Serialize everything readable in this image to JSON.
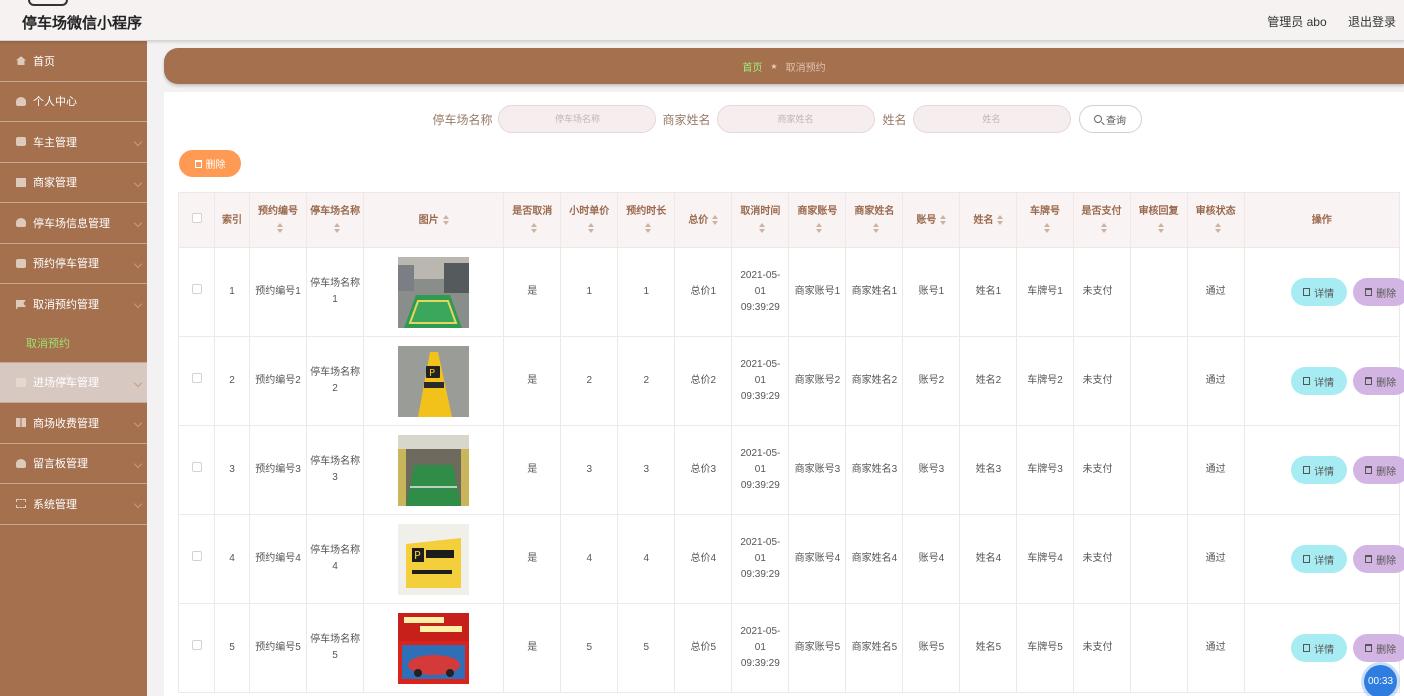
{
  "header": {
    "title": "停车场微信小程序",
    "admin": "管理员 abo",
    "logout": "退出登录"
  },
  "sidebar": {
    "items": [
      {
        "label": "首页",
        "icon": "home-icon"
      },
      {
        "label": "个人中心",
        "icon": "user-icon"
      },
      {
        "label": "车主管理",
        "icon": "car-icon"
      },
      {
        "label": "商家管理",
        "icon": "shop-icon"
      },
      {
        "label": "停车场信息管理",
        "icon": "user-icon"
      },
      {
        "label": "预约停车管理",
        "icon": "car-icon"
      },
      {
        "label": "取消预约管理",
        "icon": "flag-icon"
      },
      {
        "label": "进场停车管理",
        "icon": "shop-icon"
      },
      {
        "label": "商场收费管理",
        "icon": "grid-icon"
      },
      {
        "label": "留言板管理",
        "icon": "user-icon"
      },
      {
        "label": "系统管理",
        "icon": "frame-icon"
      }
    ],
    "submenu": {
      "label": "取消预约"
    }
  },
  "breadcrumb": {
    "home": "首页",
    "current": "取消预约"
  },
  "search": {
    "fields": [
      {
        "label": "停车场名称",
        "placeholder": "停车场名称"
      },
      {
        "label": "商家姓名",
        "placeholder": "商家姓名"
      },
      {
        "label": "姓名",
        "placeholder": "姓名"
      }
    ],
    "button": "查询"
  },
  "bulk_delete": "删除",
  "table": {
    "headers": [
      "索引",
      "预约编号",
      "停车场名称",
      "图片",
      "是否取消",
      "小时单价",
      "预约时长",
      "总价",
      "取消时间",
      "商家账号",
      "商家姓名",
      "账号",
      "姓名",
      "车牌号",
      "是否支付",
      "审核回复",
      "审核状态",
      "操作"
    ],
    "rows": [
      {
        "index": "1",
        "order_no": "预约编号1",
        "lot_name": "停车场名称1",
        "cancelled": "是",
        "unit_price": "1",
        "duration": "1",
        "total": "总价1",
        "cancel_time": "2021-05-01 09:39:29",
        "merchant_account": "商家账号1",
        "merchant_name": "商家姓名1",
        "account": "账号1",
        "name": "姓名1",
        "plate": "车牌号1",
        "paid": "未支付",
        "reply": "",
        "status": "通过"
      },
      {
        "index": "2",
        "order_no": "预约编号2",
        "lot_name": "停车场名称2",
        "cancelled": "是",
        "unit_price": "2",
        "duration": "2",
        "total": "总价2",
        "cancel_time": "2021-05-01 09:39:29",
        "merchant_account": "商家账号2",
        "merchant_name": "商家姓名2",
        "account": "账号2",
        "name": "姓名2",
        "plate": "车牌号2",
        "paid": "未支付",
        "reply": "",
        "status": "通过"
      },
      {
        "index": "3",
        "order_no": "预约编号3",
        "lot_name": "停车场名称3",
        "cancelled": "是",
        "unit_price": "3",
        "duration": "3",
        "total": "总价3",
        "cancel_time": "2021-05-01 09:39:29",
        "merchant_account": "商家账号3",
        "merchant_name": "商家姓名3",
        "account": "账号3",
        "name": "姓名3",
        "plate": "车牌号3",
        "paid": "未支付",
        "reply": "",
        "status": "通过"
      },
      {
        "index": "4",
        "order_no": "预约编号4",
        "lot_name": "停车场名称4",
        "cancelled": "是",
        "unit_price": "4",
        "duration": "4",
        "total": "总价4",
        "cancel_time": "2021-05-01 09:39:29",
        "merchant_account": "商家账号4",
        "merchant_name": "商家姓名4",
        "account": "账号4",
        "name": "姓名4",
        "plate": "车牌号4",
        "paid": "未支付",
        "reply": "",
        "status": "通过"
      },
      {
        "index": "5",
        "order_no": "预约编号5",
        "lot_name": "停车场名称5",
        "cancelled": "是",
        "unit_price": "5",
        "duration": "5",
        "total": "总价5",
        "cancel_time": "2021-05-01 09:39:29",
        "merchant_account": "商家账号5",
        "merchant_name": "商家姓名5",
        "account": "账号5",
        "name": "姓名5",
        "plate": "车牌号5",
        "paid": "未支付",
        "reply": "",
        "status": "通过"
      }
    ],
    "action_detail": "详情",
    "action_delete": "删除"
  },
  "timer": "00:33",
  "colors": {
    "sidebar_bg": "#a4704e",
    "active_submenu_text": "#9ee06f",
    "delete_button": "#ff9a55",
    "detail_button": "#a8ecf3",
    "row_delete_button": "#d2b5e2",
    "timer_badge": "#2f7de1"
  }
}
